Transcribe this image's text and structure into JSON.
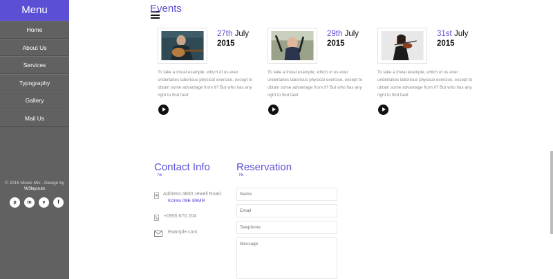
{
  "sidebar": {
    "title": "Menu",
    "items": [
      {
        "label": "Home"
      },
      {
        "label": "About Us"
      },
      {
        "label": "Services"
      },
      {
        "label": "Typography"
      },
      {
        "label": "Gallery"
      },
      {
        "label": "Mail Us"
      }
    ],
    "footer_line1": "© 2015 Music Mix . Design by",
    "footer_brand": "W3layouts",
    "social": [
      "p",
      "in",
      "v",
      "f"
    ]
  },
  "events": {
    "title": "Events",
    "items": [
      {
        "day": "27th",
        "month": "July",
        "year": "2015",
        "desc": "To take a trivial example, which of us ever undertakes laborious physical exercise, except to obtain some advantage from it? But who has any right to find fault",
        "image": "guitar-player"
      },
      {
        "day": "29th",
        "month": "July",
        "year": "2015",
        "desc": "To take a trivial example, which of us ever undertakes laborious physical exercise, except to obtain some advantage from it? But who has any right to find fault",
        "image": "bagpipe-player"
      },
      {
        "day": "31st",
        "month": "July",
        "year": "2015",
        "desc": "To take a trivial example, which of us ever undertakes laborious physical exercise, except to obtain some advantage from it? But who has any right to find fault",
        "image": "violin-player"
      }
    ]
  },
  "contact": {
    "title": "Contact Info",
    "mark": "№",
    "address_line1": "Address:4800 Jewell Road",
    "address_line2": "Korea 09E 89MR",
    "phone": "+0955 670 204",
    "email": "Example.com"
  },
  "reservation": {
    "title": "Reservation",
    "mark": "№",
    "name_placeholder": "Name",
    "email_placeholder": "Email",
    "telephone_placeholder": "Telephone",
    "message_placeholder": "Message"
  },
  "colors": {
    "accent": "#5b4fd6",
    "sidebar": "#616161"
  }
}
